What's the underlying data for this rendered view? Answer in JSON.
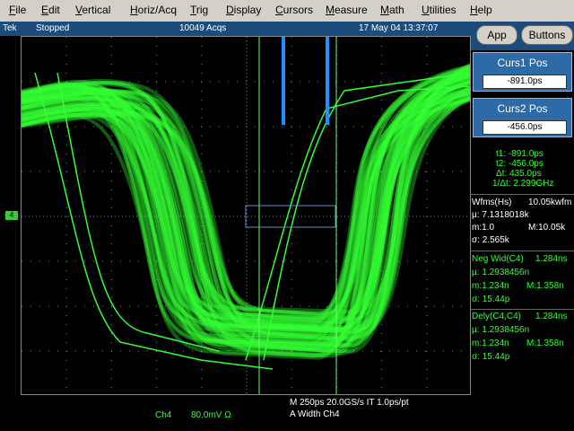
{
  "menu": {
    "items": [
      {
        "u": "F",
        "rest": "ile"
      },
      {
        "u": "E",
        "rest": "dit"
      },
      {
        "u": "V",
        "rest": "ertical"
      },
      {
        "u": "H",
        "rest": "oriz/Acq"
      },
      {
        "u": "T",
        "rest": "rig"
      },
      {
        "u": "D",
        "rest": "isplay"
      },
      {
        "u": "C",
        "rest": "ursors"
      },
      {
        "u": "M",
        "rest": "easure"
      },
      {
        "u": "M",
        "rest": "ath"
      },
      {
        "u": "U",
        "rest": "tilities"
      },
      {
        "u": "H",
        "rest": "elp"
      }
    ]
  },
  "status": {
    "brand": "Tek",
    "state": "Stopped",
    "acqs": "10049 Acqs",
    "datetime": "17 May 04 13:37:07"
  },
  "top_buttons": {
    "app": "App",
    "buttons": "Buttons"
  },
  "cursors": {
    "curs1_title": "Curs1 Pos",
    "curs1_value": "-891.0ps",
    "curs2_title": "Curs2 Pos",
    "curs2_value": "-456.0ps",
    "t1": "t1: -891.0ps",
    "t2": "t2: -456.0ps",
    "dt": "Δt:  435.0ps",
    "inv_dt": "1/Δt:  2.299GHz"
  },
  "measurements": {
    "wfms_label": "Wfms(Hs)",
    "wfms_value": "10.05kwfm",
    "wfms_mu": "μ: 7.1318018k",
    "wfms_m": "m:1.0",
    "wfms_M": "M:10.05k",
    "wfms_sigma": "σ: 2.565k",
    "negwid_label": "Neg Wid(C4)",
    "negwid_value": "1.284ns",
    "negwid_mu": "μ: 1.2938456n",
    "negwid_m": "m:1.234n",
    "negwid_M": "M:1.358n",
    "negwid_sigma": "σ: 15.44p",
    "dely_label": "Dely(C4,C4)",
    "dely_value": "1.284ns",
    "dely_mu": "μ: 1.2938456n",
    "dely_m": "m:1.234n",
    "dely_M": "M:1.358n",
    "dely_sigma": "σ: 15.44p"
  },
  "bottom": {
    "horiz": "M 250ps 20.0GS/s IT 1.0ps/pt",
    "trig": "A  Width    Ch4",
    "channel": "Ch4",
    "volts": "80.0mV  Ω"
  },
  "channel_marker": "4",
  "colors": {
    "trace": "#33ff33",
    "status_bar": "#1b4c7c",
    "cursor_box": "#2e6aa5",
    "cursor_marker": "#1e90ff",
    "grid": "#808080"
  }
}
